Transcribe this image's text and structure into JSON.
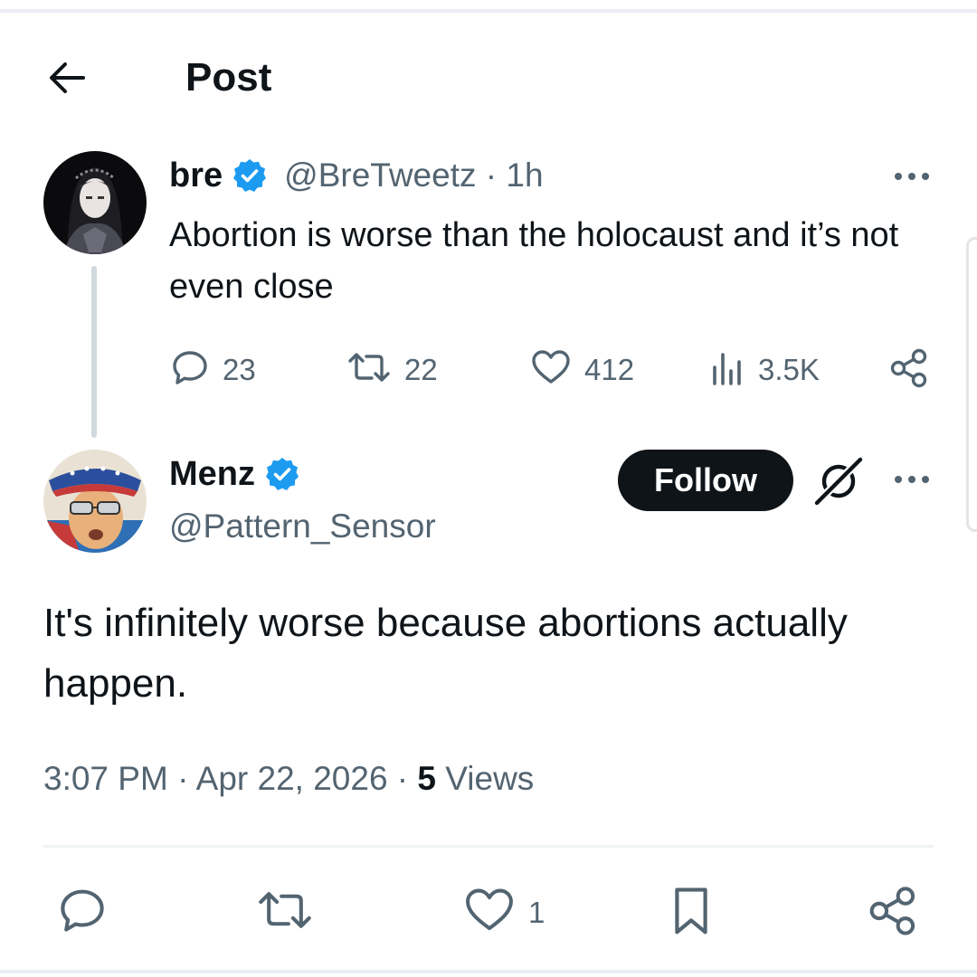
{
  "header": {
    "title": "Post",
    "back_icon": "arrow-left-icon"
  },
  "parent_post": {
    "author": {
      "display_name": "bre",
      "handle": "@BreTweetz",
      "verified": true
    },
    "time_separator": " · ",
    "time": "1h",
    "text": "Abortion is worse than the holocaust and it’s not even close",
    "stats": {
      "replies": "23",
      "reposts": "22",
      "likes": "412",
      "views": "3.5K"
    }
  },
  "reply_post": {
    "author": {
      "display_name": "Menz",
      "handle": "@Pattern_Sensor",
      "verified": true
    },
    "follow_label": "Follow",
    "text": "It's infinitely worse because abortions actually happen.",
    "time": "3:07 PM",
    "date": "Apr 22, 2026",
    "separator": " · ",
    "views_count": "5",
    "views_label": "Views"
  },
  "action_bar": {
    "likes": "1"
  },
  "colors": {
    "accent_blue": "#1d9bf0",
    "text_primary": "#0f1419",
    "text_secondary": "#536471",
    "thread_line": "#cfd9de"
  }
}
